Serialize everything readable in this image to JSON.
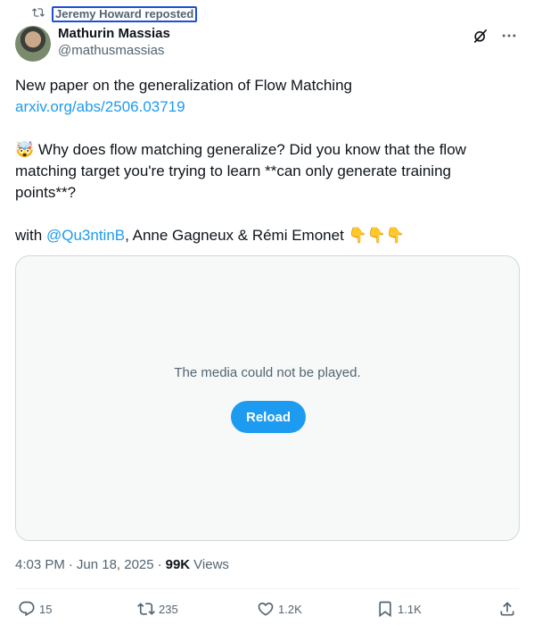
{
  "repost": {
    "label": "Jeremy Howard reposted",
    "icon": "repost-icon"
  },
  "author": {
    "name": "Mathurin Massias",
    "handle": "@mathusmassias"
  },
  "tweet": {
    "line1": "New paper on the generalization of Flow Matching",
    "link": "arxiv.org/abs/2506.03719",
    "emoji_head": "🤯",
    "question": " Why does flow matching generalize? Did you know that the flow matching target you're trying to learn **can only generate training points**?",
    "with_prefix": "with ",
    "mention": "@Qu3ntinB",
    "with_suffix": ", Anne Gagneux & Rémi Emonet ",
    "pointing_emojis": "👇👇👇"
  },
  "media": {
    "message": "The media could not be played.",
    "reload_label": "Reload"
  },
  "meta": {
    "time": "4:03 PM",
    "sep1": "·",
    "date": "Jun 18, 2025",
    "sep2": "·",
    "views_count": "99K",
    "views_label": "Views"
  },
  "actions": {
    "replies": "15",
    "reposts": "235",
    "likes": "1.2K",
    "bookmarks": "1.1K"
  },
  "colors": {
    "accent": "#1d9bf0",
    "secondary_text": "#536471",
    "primary_text": "#0f1419"
  }
}
